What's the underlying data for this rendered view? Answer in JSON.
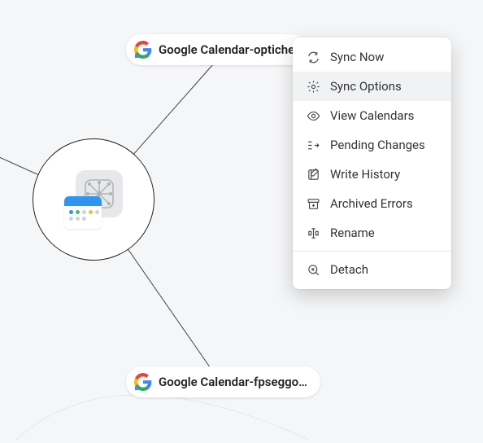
{
  "nodes": {
    "top": {
      "label": "Google Calendar-optiche"
    },
    "bottom": {
      "label": "Google Calendar-fpseggo…"
    }
  },
  "menu": {
    "sync_now": "Sync Now",
    "sync_options": "Sync Options",
    "view_calendars": "View Calendars",
    "pending_changes": "Pending Changes",
    "write_history": "Write History",
    "archived_errors": "Archived Errors",
    "rename": "Rename",
    "detach": "Detach"
  }
}
